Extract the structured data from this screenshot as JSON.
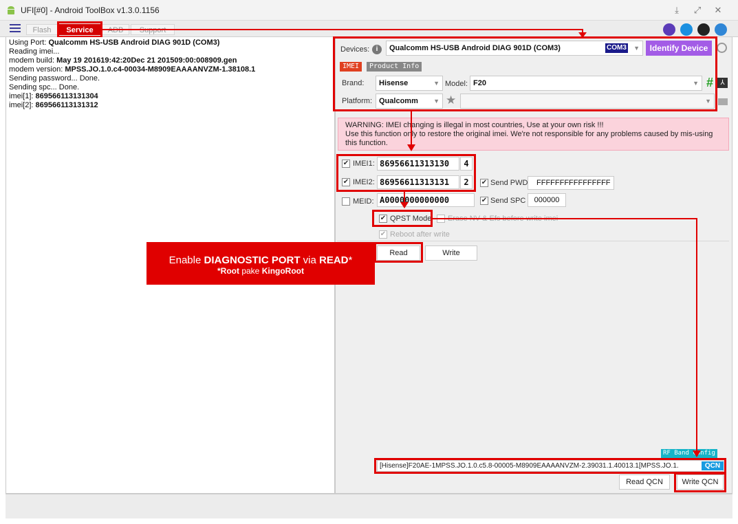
{
  "window": {
    "title": "UFI[#0] - Android ToolBox v1.3.0.1156"
  },
  "tabs": [
    {
      "label": "Flash"
    },
    {
      "label": "Service"
    },
    {
      "label": "ADB"
    },
    {
      "label": "Support"
    }
  ],
  "log": {
    "lines": [
      {
        "prefix": "Using Port: ",
        "value": "Qualcomm HS-USB Android DIAG 901D (COM3)"
      },
      {
        "prefix": "Reading imei...",
        "value": ""
      },
      {
        "prefix": " modem build: ",
        "value": "May 19 201619:42:20Dec 21 201509:00:008909.gen"
      },
      {
        "prefix": " modem version: ",
        "value": "MPSS.JO.1.0.c4-00034-M8909EAAAANVZM-1.38108.1"
      },
      {
        "prefix": "Sending password... Done.",
        "value": ""
      },
      {
        "prefix": "Sending spc... Done.",
        "value": ""
      },
      {
        "prefix": " imei[1]: ",
        "value": "869566113131304"
      },
      {
        "prefix": " imei[2]: ",
        "value": "869566113131312"
      }
    ]
  },
  "devices": {
    "label": "Devices:",
    "selected": "Qualcomm HS-USB Android DIAG 901D (COM3)",
    "port_badge": "COM3",
    "identify_label": "Identify Device"
  },
  "subtabs": [
    {
      "label": "IMEI"
    },
    {
      "label": "Product Info"
    }
  ],
  "brand": {
    "label": "Brand:",
    "value": "Hisense"
  },
  "model": {
    "label": "Model:",
    "value": "F20"
  },
  "platform": {
    "label": "Platform:",
    "value": "Qualcomm",
    "extra_value": ""
  },
  "warning": {
    "line1": "WARNING: IMEI changing is illegal in most countries, Use at your own risk !!!",
    "line2": "Use this function only to restore the original imei. We're not responsible for any problems caused by mis-using",
    "line3": "this function."
  },
  "imei1": {
    "label": "IMEI1:",
    "value": "86956611313130",
    "check": "4"
  },
  "imei2": {
    "label": "IMEI2:",
    "value": "86956611313131",
    "check": "2"
  },
  "meid": {
    "label": "MEID:",
    "value": "A0000000000000"
  },
  "send_pwd": {
    "label": "Send PWD",
    "value": "FFFFFFFFFFFFFFFF"
  },
  "send_spc": {
    "label": "Send SPC",
    "value": "000000"
  },
  "options": {
    "qpst": "QPST Mode",
    "erase": "Erase NV & Efs before write imei",
    "reboot": "Reboot after write"
  },
  "actions": {
    "read": "Read",
    "write": "Write"
  },
  "qcn": {
    "rf_band": "RF Band Config",
    "file": "[Hisense]F20AE-1MPSS.JO.1.0.c5.8-00005-M8909EAAAANVZM-2.39031.1.40013.1[MPSS.JO.1.",
    "badge": "QCN",
    "read_label": "Read QCN",
    "write_label": "Write QCN"
  },
  "callout": {
    "pre": "Enable ",
    "bold1": "DIAGNOSTIC PORT",
    "mid": " via ",
    "bold2": "READ",
    "post": "*",
    "line2_a": "*Root",
    "line2_b": " pake ",
    "line2_c": "KingoRoot"
  },
  "colors": {
    "accent_red": "#e00000",
    "identify_purple": "#a35ce6",
    "badge_blue": "#1a9be0"
  }
}
